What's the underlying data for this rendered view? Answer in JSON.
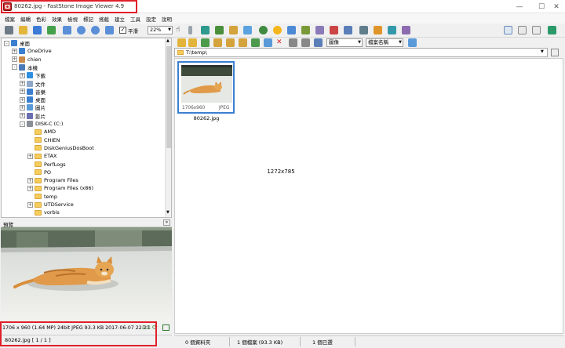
{
  "window": {
    "title": "80262.jpg  -  FastStone Image Viewer 4.9",
    "controls": {
      "minimize": "—",
      "maximize": "☐",
      "close": "✕"
    }
  },
  "menu": [
    "檔案",
    "編輯",
    "色彩",
    "效果",
    "檢視",
    "標記",
    "搖截",
    "建立",
    "工具",
    "設定",
    "說明"
  ],
  "toolbar": {
    "zoom_value": "22%",
    "smooth_label": "平滑",
    "smooth_checked": true
  },
  "nav": {
    "filter_value": "圖像",
    "sort_value": "檔案名稱"
  },
  "path": "T:\\temp\\",
  "tree": [
    {
      "label": "桌面",
      "level": 0,
      "expander": "-",
      "icon": "desktop-icon"
    },
    {
      "label": "OneDrive",
      "level": 1,
      "expander": "+",
      "icon": "cloud-icon"
    },
    {
      "label": "chien",
      "level": 1,
      "expander": "+",
      "icon": "user-icon"
    },
    {
      "label": "本機",
      "level": 1,
      "expander": "-",
      "icon": "computer-icon"
    },
    {
      "label": "下載",
      "level": 2,
      "expander": "+",
      "icon": "download-icon"
    },
    {
      "label": "文件",
      "level": 2,
      "expander": "+",
      "icon": "document-icon"
    },
    {
      "label": "音樂",
      "level": 2,
      "expander": "+",
      "icon": "music-icon"
    },
    {
      "label": "桌面",
      "level": 2,
      "expander": "+",
      "icon": "desktop-icon"
    },
    {
      "label": "圖片",
      "level": 2,
      "expander": "+",
      "icon": "pictures-icon"
    },
    {
      "label": "影片",
      "level": 2,
      "expander": "+",
      "icon": "video-icon"
    },
    {
      "label": "DISK-C (C:)",
      "level": 2,
      "expander": "-",
      "icon": "drive-icon"
    },
    {
      "label": "AMD",
      "level": 3,
      "expander": "",
      "icon": "folder-icon"
    },
    {
      "label": "CHIEN",
      "level": 3,
      "expander": "",
      "icon": "folder-icon"
    },
    {
      "label": "DiskGeniusDosBoot",
      "level": 3,
      "expander": "",
      "icon": "folder-icon"
    },
    {
      "label": "ETAX",
      "level": 3,
      "expander": "+",
      "icon": "folder-icon"
    },
    {
      "label": "PerfLogs",
      "level": 3,
      "expander": "",
      "icon": "folder-icon"
    },
    {
      "label": "PO",
      "level": 3,
      "expander": "",
      "icon": "folder-icon"
    },
    {
      "label": "Program Files",
      "level": 3,
      "expander": "+",
      "icon": "folder-icon"
    },
    {
      "label": "Program Files (x86)",
      "level": 3,
      "expander": "+",
      "icon": "folder-icon"
    },
    {
      "label": "temp",
      "level": 3,
      "expander": "",
      "icon": "folder-icon"
    },
    {
      "label": "UTDService",
      "level": 3,
      "expander": "+",
      "icon": "folder-icon"
    },
    {
      "label": "vorbis",
      "level": 3,
      "expander": "",
      "icon": "folder-icon"
    },
    {
      "label": "Windows",
      "level": 3,
      "expander": "+",
      "icon": "folder-icon"
    }
  ],
  "preview": {
    "header": "預覽",
    "info": "1706 x 960 (1.64 MP)  24bit  JPEG   93.3 KB   2017-06-07 22:21",
    "status": "80262.jpg [ 1 / 1 ]"
  },
  "thumbnail": {
    "dims": "1706x960",
    "format": "JPEG",
    "name": "80262.jpg"
  },
  "center_text": "1272x785",
  "status": {
    "folders": "0 個資料夾",
    "files": "1 個檔案 (93.3 KB)",
    "selected": "1 個已選"
  }
}
